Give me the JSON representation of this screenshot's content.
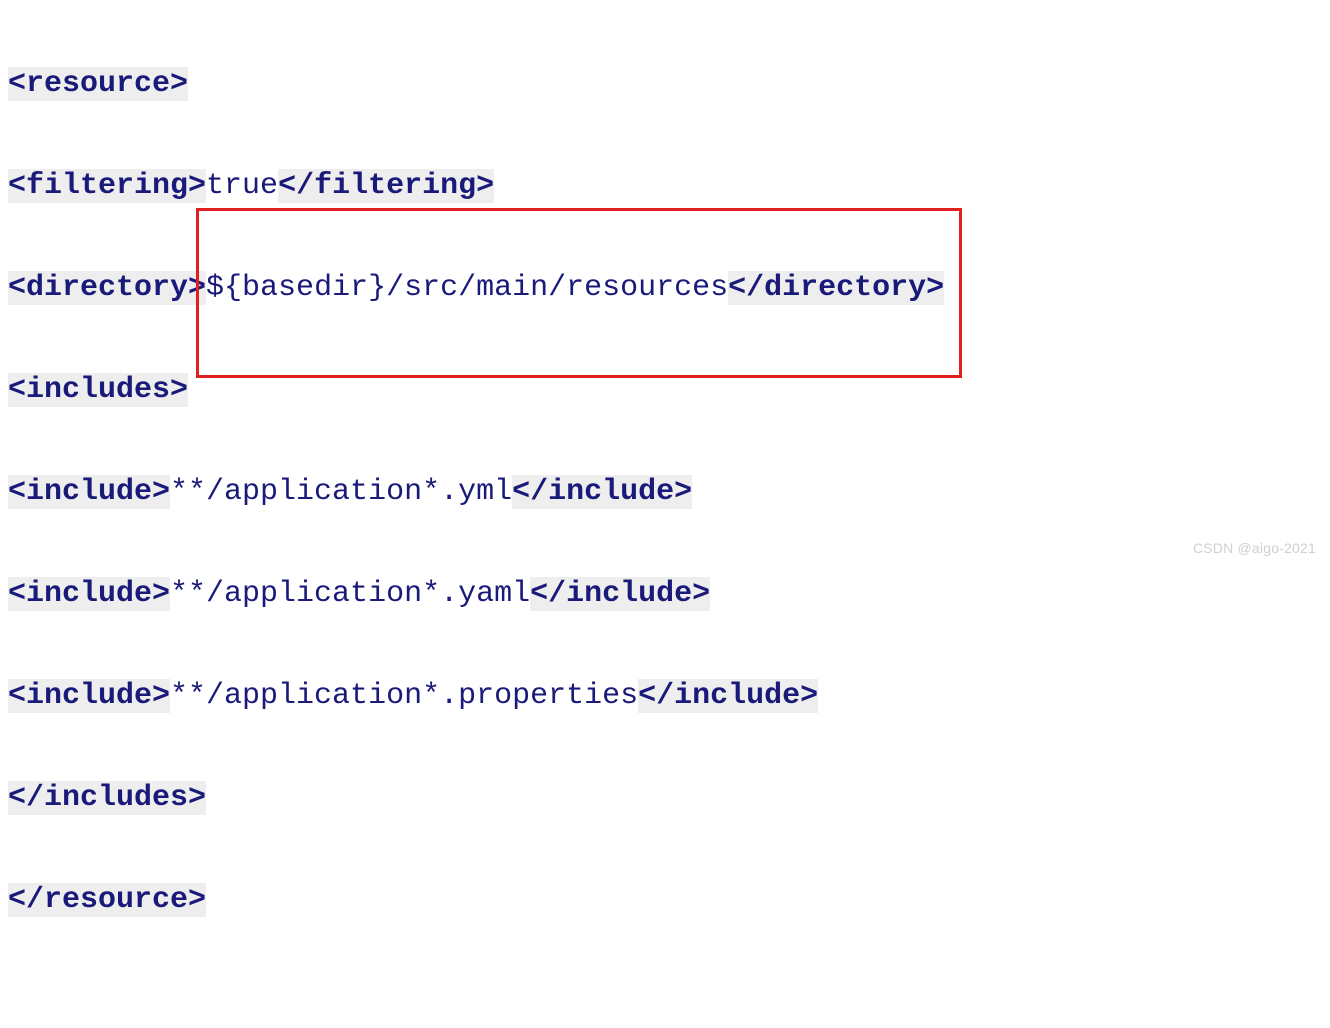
{
  "code": {
    "line1": {
      "open": "<resource>"
    },
    "line2": {
      "open": "<filtering>",
      "text": "true",
      "close": "</filtering>"
    },
    "line3": {
      "open": "<directory>",
      "text": "${basedir}/src/main/resources",
      "close": "</directory>"
    },
    "line4": {
      "open": "<includes>"
    },
    "line5": {
      "open": "<include>",
      "text": "**/application*.yml",
      "close": "</include>"
    },
    "line6": {
      "open": "<include>",
      "text": "**/application*.yaml",
      "close": "</include>"
    },
    "line7": {
      "open": "<include>",
      "text": "**/application*.properties",
      "close": "</include>"
    },
    "line8": {
      "close": "</includes>"
    },
    "line9": {
      "close": "</resource>"
    }
  },
  "watermark": "CSDN @aigo-2021"
}
